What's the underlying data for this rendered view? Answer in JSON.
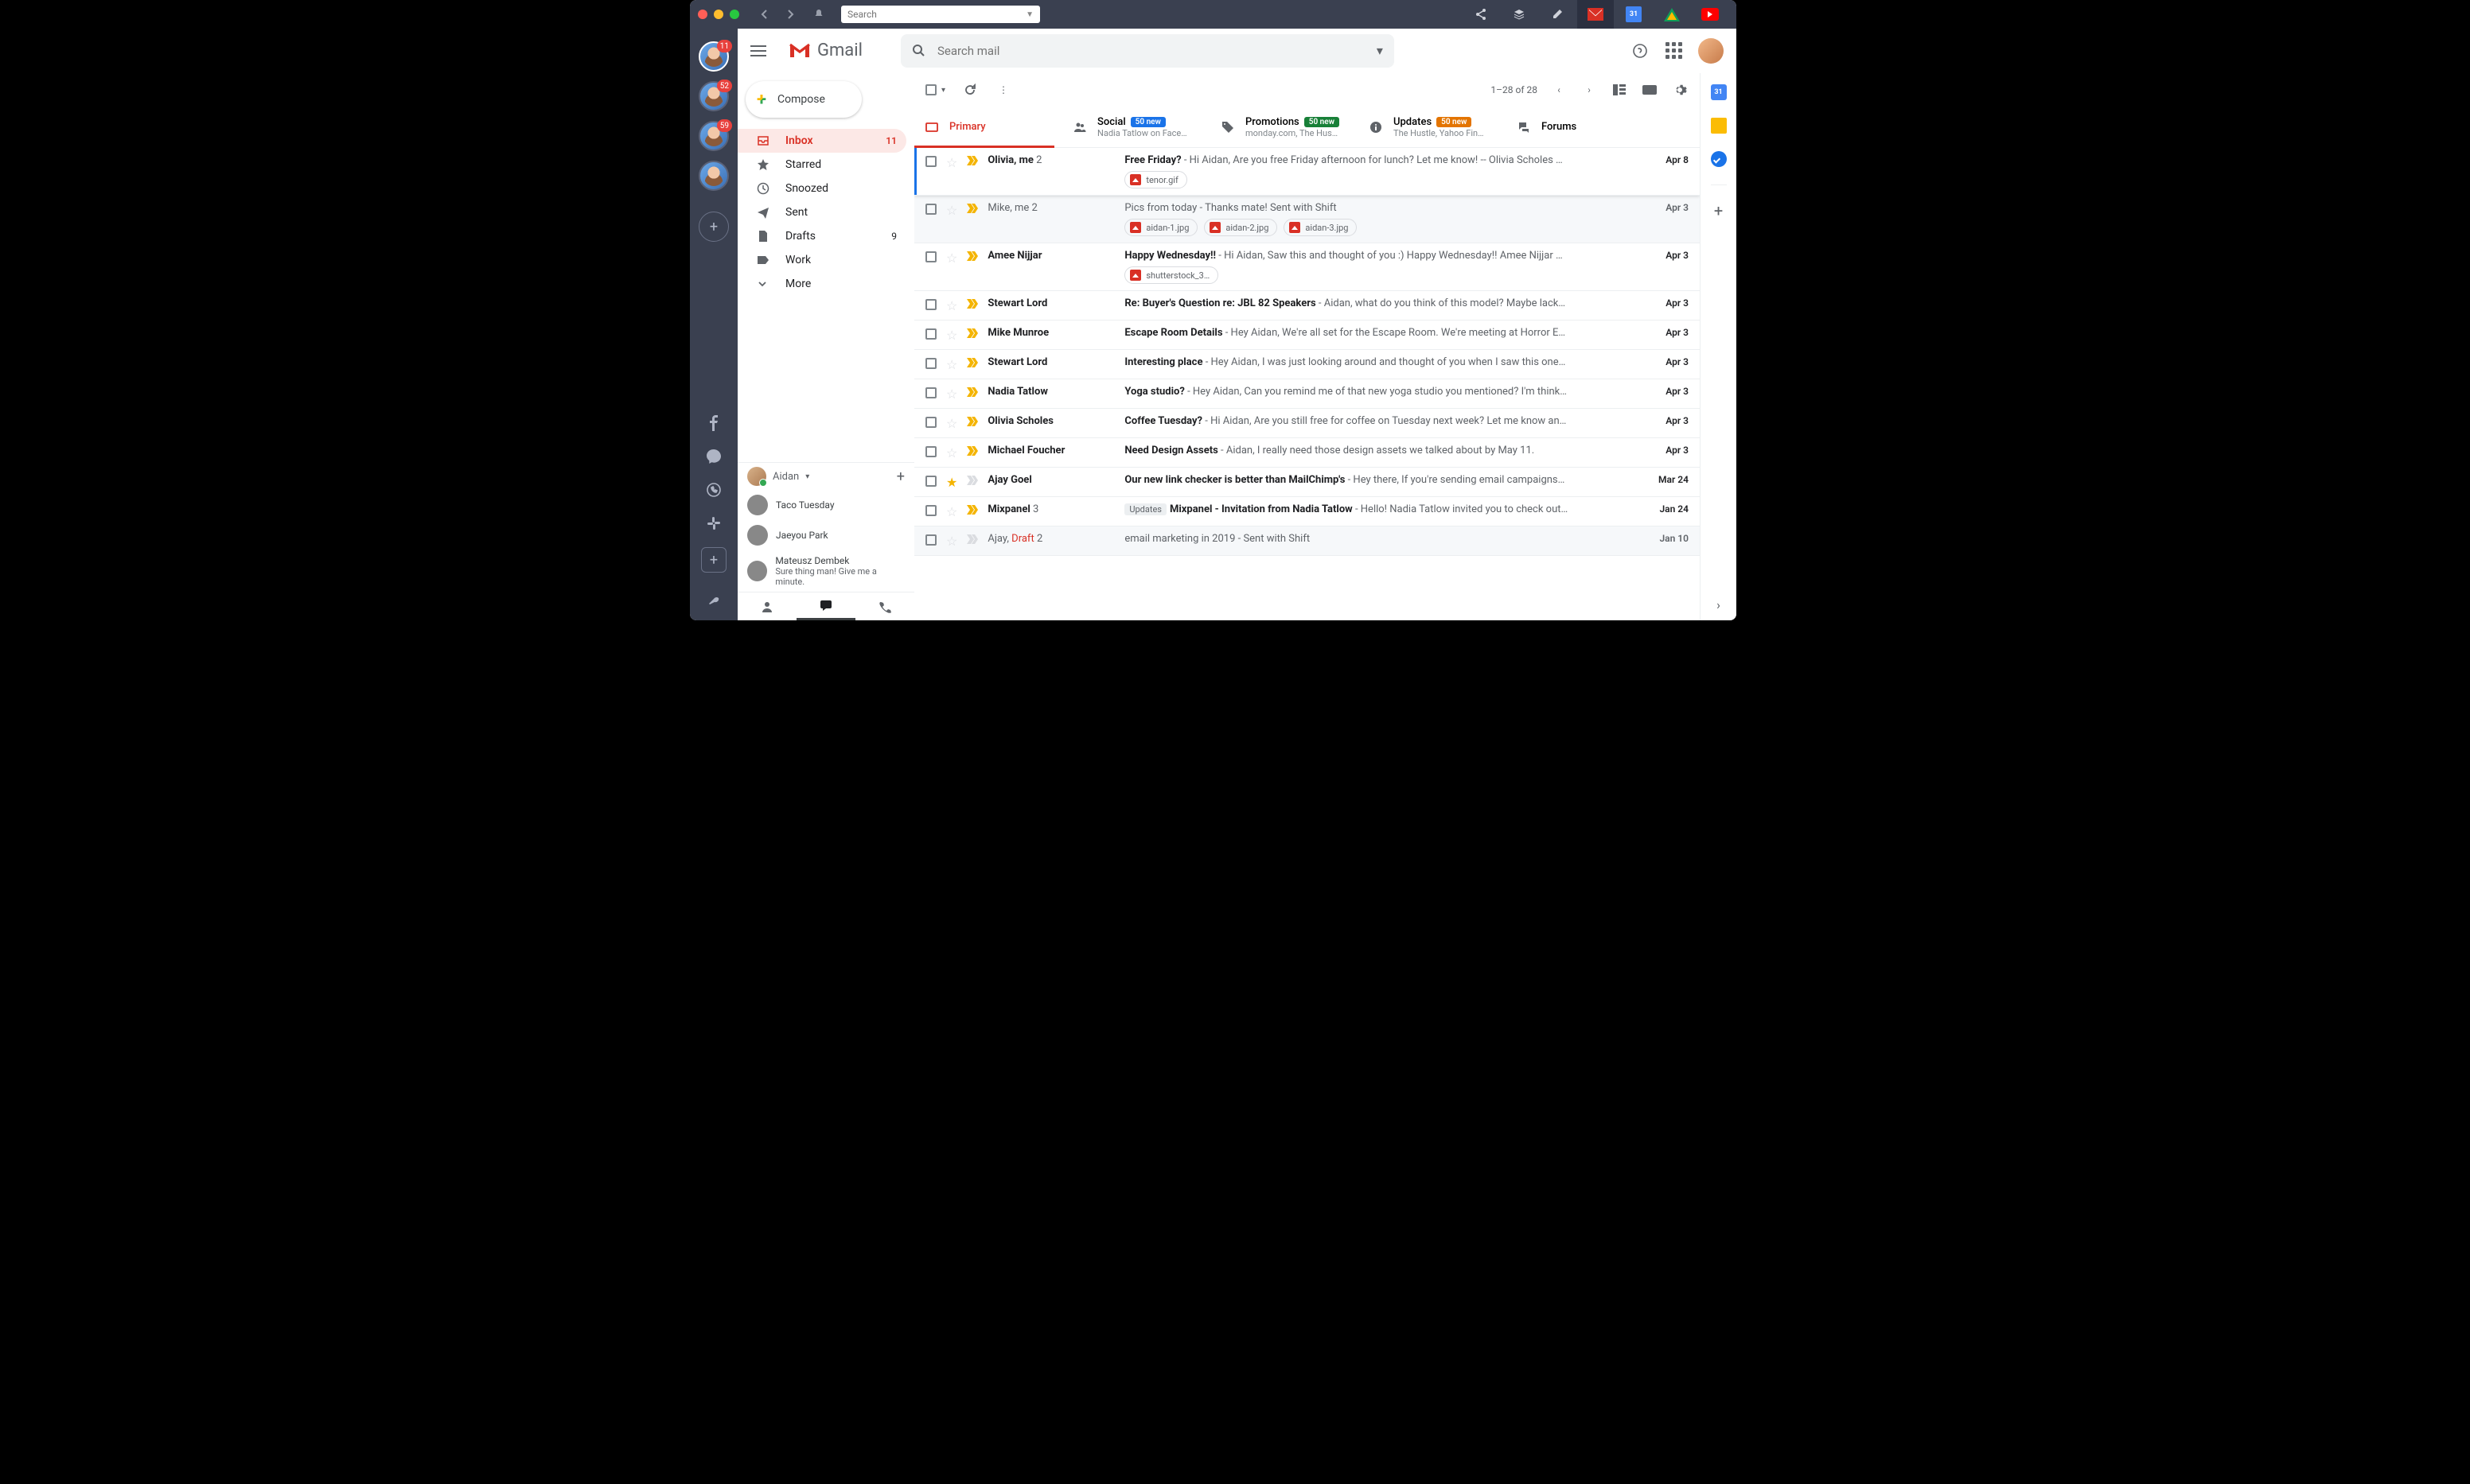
{
  "titlebar": {
    "search_placeholder": "Search",
    "calendar_day": "31"
  },
  "shift": {
    "accounts": [
      {
        "badge": "11",
        "selected": true
      },
      {
        "badge": "52",
        "selected": false
      },
      {
        "badge": "59",
        "selected": false
      },
      {
        "badge": "",
        "selected": false
      }
    ]
  },
  "header": {
    "brand": "Gmail",
    "search_placeholder": "Search mail"
  },
  "compose_label": "Compose",
  "nav": [
    {
      "icon": "inbox",
      "label": "Inbox",
      "count": "11",
      "active": true
    },
    {
      "icon": "star",
      "label": "Starred",
      "count": "",
      "active": false
    },
    {
      "icon": "clock",
      "label": "Snoozed",
      "count": "",
      "active": false
    },
    {
      "icon": "send",
      "label": "Sent",
      "count": "",
      "active": false
    },
    {
      "icon": "file",
      "label": "Drafts",
      "count": "9",
      "active": false
    },
    {
      "icon": "label",
      "label": "Work",
      "count": "",
      "active": false
    },
    {
      "icon": "more",
      "label": "More",
      "count": "",
      "active": false
    }
  ],
  "hangouts": {
    "me": "Aidan",
    "contacts": [
      {
        "name": "Taco Tuesday",
        "sub": ""
      },
      {
        "name": "Jaeyou Park",
        "sub": ""
      },
      {
        "name": "Mateusz Dembek",
        "sub": "Sure thing man! Give me a minute."
      }
    ]
  },
  "pager": "1–28 of 28",
  "tabs": {
    "primary": "Primary",
    "social": {
      "label": "Social",
      "pill": "50 new",
      "sub": "Nadia Tatlow on Face…"
    },
    "promotions": {
      "label": "Promotions",
      "pill": "50 new",
      "sub": "monday.com, The Hus…"
    },
    "updates": {
      "label": "Updates",
      "pill": "50 new",
      "sub": "The Hustle, Yahoo Fin…"
    },
    "forums": "Forums"
  },
  "emails": [
    {
      "unread": true,
      "selected": true,
      "star": false,
      "important": true,
      "sender": "Olivia, me",
      "count": "2",
      "subject": "Free Friday?",
      "preview": " - Hi Aidan, Are you free Friday afternoon for lunch? Let me know! -- Olivia Scholes …",
      "date": "Apr 8",
      "chips": [
        "tenor.gif"
      ]
    },
    {
      "unread": false,
      "star": false,
      "important": true,
      "sender": "Mike, me",
      "count": "2",
      "subject": "Pics from today",
      "preview": " - Thanks mate! Sent with Shift",
      "date": "Apr 3",
      "chips": [
        "aidan-1.jpg",
        "aidan-2.jpg",
        "aidan-3.jpg"
      ]
    },
    {
      "unread": true,
      "star": false,
      "important": true,
      "sender": "Amee Nijjar",
      "count": "",
      "subject": "Happy Wednesday!!",
      "preview": " - Hi Aidan, Saw this and thought of you :) Happy Wednesday!! Amee Nijjar …",
      "date": "Apr 3",
      "chips": [
        "shutterstock_3…"
      ]
    },
    {
      "unread": true,
      "star": false,
      "important": true,
      "sender": "Stewart Lord",
      "count": "",
      "subject": "Re: Buyer's Question re: JBL 82 Speakers",
      "preview": " - Aidan, what do you think of this model? Maybe lack…",
      "date": "Apr 3",
      "chips": []
    },
    {
      "unread": true,
      "star": false,
      "important": true,
      "sender": "Mike Munroe",
      "count": "",
      "subject": "Escape Room Details",
      "preview": " - Hey Aidan, We're all set for the Escape Room. We're meeting at Horror E…",
      "date": "Apr 3",
      "chips": []
    },
    {
      "unread": true,
      "star": false,
      "important": true,
      "sender": "Stewart Lord",
      "count": "",
      "subject": "Interesting place",
      "preview": " - Hey Aidan, I was just looking around and thought of you when I saw this one…",
      "date": "Apr 3",
      "chips": []
    },
    {
      "unread": true,
      "star": false,
      "important": true,
      "sender": "Nadia Tatlow",
      "count": "",
      "subject": "Yoga studio?",
      "preview": " - Hey Aidan, Can you remind me of that new yoga studio you mentioned? I'm think…",
      "date": "Apr 3",
      "chips": []
    },
    {
      "unread": true,
      "star": false,
      "important": true,
      "sender": "Olivia Scholes",
      "count": "",
      "subject": "Coffee Tuesday?",
      "preview": " - Hi Aidan, Are you still free for coffee on Tuesday next week? Let me know an…",
      "date": "Apr 3",
      "chips": []
    },
    {
      "unread": true,
      "star": false,
      "important": true,
      "sender": "Michael Foucher",
      "count": "",
      "subject": "Need Design Assets",
      "preview": " - Aidan, I really need those design assets we talked about by May 11.",
      "date": "Apr 3",
      "chips": []
    },
    {
      "unread": true,
      "star": true,
      "important": false,
      "sender": "Ajay Goel",
      "count": "",
      "subject": "Our new link checker is better than MailChimp's",
      "preview": " - Hey there, If you're sending email campaigns…",
      "date": "Mar 24",
      "chips": []
    },
    {
      "unread": true,
      "star": false,
      "important": true,
      "sender": "Mixpanel",
      "count": "3",
      "label": "Updates",
      "subject": "Mixpanel - Invitation from Nadia Tatlow",
      "preview": " - Hello! Nadia Tatlow invited you to check out…",
      "date": "Jan 24",
      "chips": []
    },
    {
      "unread": false,
      "star": false,
      "important": false,
      "sender": "Ajay, ",
      "draft": "Draft",
      "count": "2",
      "subject": "email marketing in 2019",
      "preview": " - Sent with Shift",
      "date": "Jan 10",
      "chips": []
    }
  ],
  "rail_calendar_day": "31"
}
